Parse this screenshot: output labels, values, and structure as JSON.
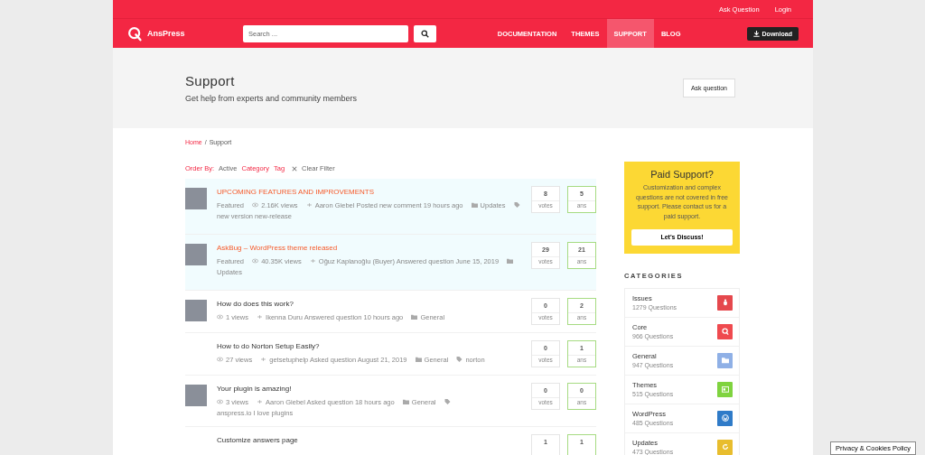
{
  "top_links": [
    "Ask Question",
    "Login"
  ],
  "brand": "AnsPress",
  "search": {
    "placeholder": "Search ..."
  },
  "nav": [
    {
      "label": "DOCUMENTATION",
      "selected": false
    },
    {
      "label": "THEMES",
      "selected": false
    },
    {
      "label": "SUPPORT",
      "selected": true
    },
    {
      "label": "BLOG",
      "selected": false
    }
  ],
  "download_button": "Download",
  "page_header": {
    "title": "Support",
    "subtitle": "Get help from experts and community members",
    "button": "Ask question"
  },
  "breadcrumb": {
    "home": "Home",
    "separator": "/",
    "current": "Support"
  },
  "filters": {
    "order_label": "Order By:",
    "order_value": "Active",
    "category": "Category",
    "tag": "Tag",
    "clear": "Clear Filter"
  },
  "questions": [
    {
      "title": "UPCOMING FEATURES AND IMPROVEMENTS",
      "featured": true,
      "avatar": true,
      "featured_label": "Featured",
      "views": "2.16K views",
      "activity": "Aaron Giebel Posted new comment 19 hours ago",
      "category": "Updates",
      "tags": "new version new-release",
      "votes": "8",
      "votes_label": "votes",
      "answers": "5",
      "answers_label": "ans"
    },
    {
      "title": "AskBug – WordPress theme released",
      "featured": true,
      "avatar": true,
      "featured_label": "Featured",
      "views": "40.35K views",
      "activity": "Oğuz Kaplanoğlu (Buyer) Answered question June 15, 2019",
      "category": "Updates",
      "votes": "29",
      "votes_label": "votes",
      "answers": "21",
      "answers_label": "ans"
    },
    {
      "title": "How do does this work?",
      "featured": false,
      "avatar": true,
      "views": "1 views",
      "activity": "Ikenna Duru Answered question 10 hours ago",
      "category": "General",
      "votes": "0",
      "votes_label": "votes",
      "answers": "2",
      "answers_label": "ans"
    },
    {
      "title": "How to do Norton Setup Easily?",
      "featured": false,
      "avatar": false,
      "views": "27 views",
      "activity": "getsetuphelp Asked question August 21, 2019",
      "category": "General",
      "tags": "norton",
      "votes": "0",
      "votes_label": "votes",
      "answers": "1",
      "answers_label": "ans"
    },
    {
      "title": "Your plugin is amazing!",
      "featured": false,
      "avatar": true,
      "views": "3 views",
      "activity": "Aaron Giebel Asked question 18 hours ago",
      "category": "General",
      "tags": "anspress.io I love plugins",
      "votes": "0",
      "votes_label": "votes",
      "answers": "0",
      "answers_label": "ans"
    },
    {
      "title": "Customize answers page",
      "featured": false,
      "avatar": false,
      "votes": "1",
      "answers": "1"
    }
  ],
  "paid_support": {
    "title": "Paid Support?",
    "text": "Customization and complex questions are not covered in free support. Please contact us for a paid support.",
    "button": "Let's Discuss!"
  },
  "categories_heading": "CATEGORIES",
  "categories": [
    {
      "name": "Issues",
      "count": "1279 Questions",
      "color": "#e5484d"
    },
    {
      "name": "Core",
      "count": "966 Questions",
      "color": "#ef4a4f"
    },
    {
      "name": "General",
      "count": "947 Questions",
      "color": "#8fb0e6"
    },
    {
      "name": "Themes",
      "count": "515 Questions",
      "color": "#7fd33f"
    },
    {
      "name": "WordPress",
      "count": "485 Questions",
      "color": "#2f7bc8"
    },
    {
      "name": "Updates",
      "count": "473 Questions",
      "color": "#e8bd2e"
    }
  ],
  "cookie_button": "Privacy & Cookies Policy"
}
